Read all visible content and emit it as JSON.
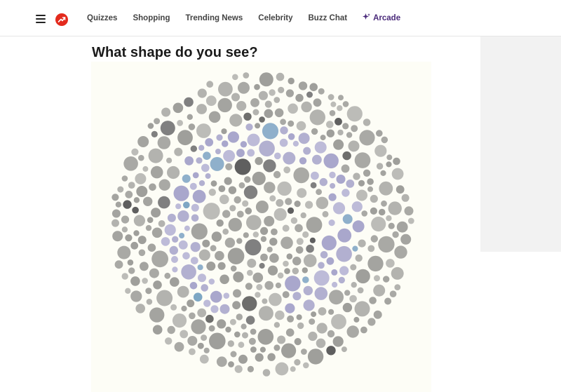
{
  "nav": {
    "items": [
      {
        "label": "Quizzes"
      },
      {
        "label": "Shopping"
      },
      {
        "label": "Trending News"
      },
      {
        "label": "Celebrity"
      },
      {
        "label": "Buzz Chat"
      },
      {
        "label": "Arcade"
      }
    ],
    "menu_icon": "hamburger-menu-icon",
    "logo_icon": "trending-arrow-icon",
    "arcade_icon": "sparkle-icon"
  },
  "colors": {
    "brand_red": "#e32a1d",
    "arcade_purple": "#4a2a7a",
    "dot_gray": "#a8a8a4",
    "dot_dark": "#6e6e6c",
    "dot_lavender": "#b2b0d0",
    "dot_blue": "#7ea7c4"
  },
  "main": {
    "title": "What shape do you see?"
  }
}
